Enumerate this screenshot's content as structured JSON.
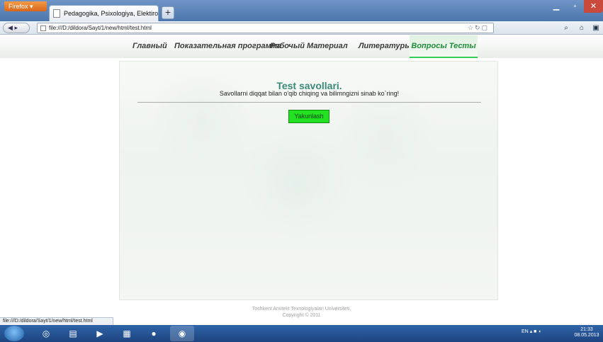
{
  "browser": {
    "app_button": "Firefox",
    "tab_title": "Pedagogika, Psixologiya, Elektiron darsli...",
    "new_tab": "+",
    "url": "file:///D:/dildora/Sayt/1/new/html/test.html",
    "status_text": "file:///D:/dildora/Sayt/1/new/html/test.html"
  },
  "menu": {
    "items": [
      {
        "label": "Главный"
      },
      {
        "label": "Показательная программа"
      },
      {
        "label": "Рабочый Материал"
      },
      {
        "label": "Литературы"
      },
      {
        "label": "Вопросы Тесты"
      }
    ],
    "active_index": 4
  },
  "content": {
    "title": "Test savollari.",
    "subtitle": "Savollarni diqqat bilan o'qib chiqing va bilimngizni sinab ko`ring!",
    "finish_button": "Yakunlash"
  },
  "footer": {
    "line1": "Toshkent Arxitekt Texnologiyalari Universiteti.",
    "line2": "Copyright © 2011"
  },
  "taskbar": {
    "language": "EN",
    "time": "21:33",
    "date": "08.05.2013"
  },
  "colors": {
    "accent_green": "#33cc55",
    "button_green": "#22e022",
    "title_teal": "#3a8a77"
  },
  "icons": [
    "firefox-logo-icon",
    "page-icon",
    "back-icon",
    "forward-icon",
    "bookmark-star-icon",
    "reload-icon",
    "search-icon",
    "home-icon",
    "start-orb-icon",
    "flag-icon",
    "speaker-icon"
  ]
}
